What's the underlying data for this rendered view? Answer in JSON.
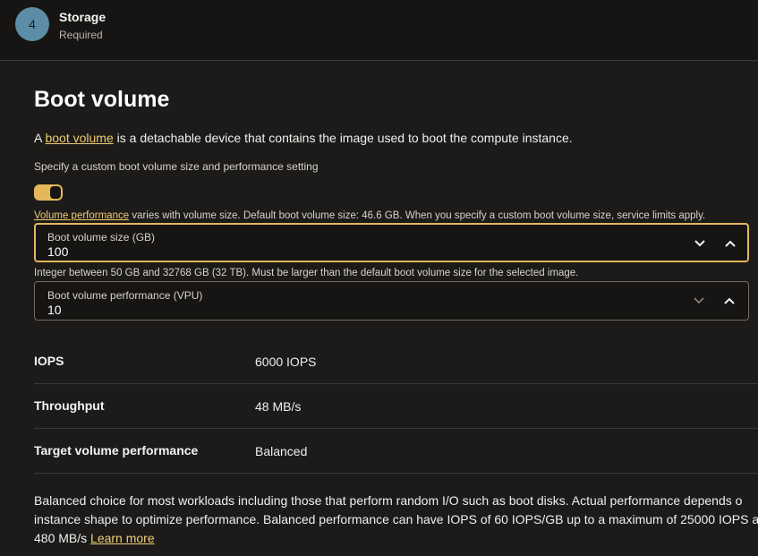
{
  "step": {
    "number": "4",
    "title": "Storage",
    "subtitle": "Required"
  },
  "section": {
    "title": "Boot volume",
    "description_prefix": "A ",
    "description_link": "boot volume",
    "description_suffix": " is a detachable device that contains the image used to boot the compute instance.",
    "toggle_label": "Specify a custom boot volume size and performance setting",
    "toggle_on": true,
    "perf_link": "Volume performance",
    "perf_note": " varies with volume size. Default boot volume size: 46.6 GB. When you specify a custom boot volume size, service limits apply."
  },
  "size_field": {
    "label": "Boot volume size (GB)",
    "value": "100"
  },
  "size_hint": "Integer between 50 GB and 32768 GB (32 TB). Must be larger than the default boot volume size for the selected image.",
  "vpu_field": {
    "label": "Boot volume performance (VPU)",
    "value": "10"
  },
  "metrics": [
    {
      "label": "IOPS",
      "value": "6000 IOPS"
    },
    {
      "label": "Throughput",
      "value": "48 MB/s"
    },
    {
      "label": "Target volume performance",
      "value": "Balanced"
    }
  ],
  "footer": {
    "line1": "Balanced choice for most workloads including those that perform random I/O such as boot disks. Actual performance depends o",
    "line2": "instance shape to optimize performance. Balanced performance can have IOPS of 60 IOPS/GB up to a maximum of 25000 IOPS a",
    "line3_prefix": "480 MB/s ",
    "learn_more": "Learn more"
  },
  "colors": {
    "accent": "#e3b75a",
    "link": "#f0cc71",
    "step_circle": "#5b8ea6"
  }
}
